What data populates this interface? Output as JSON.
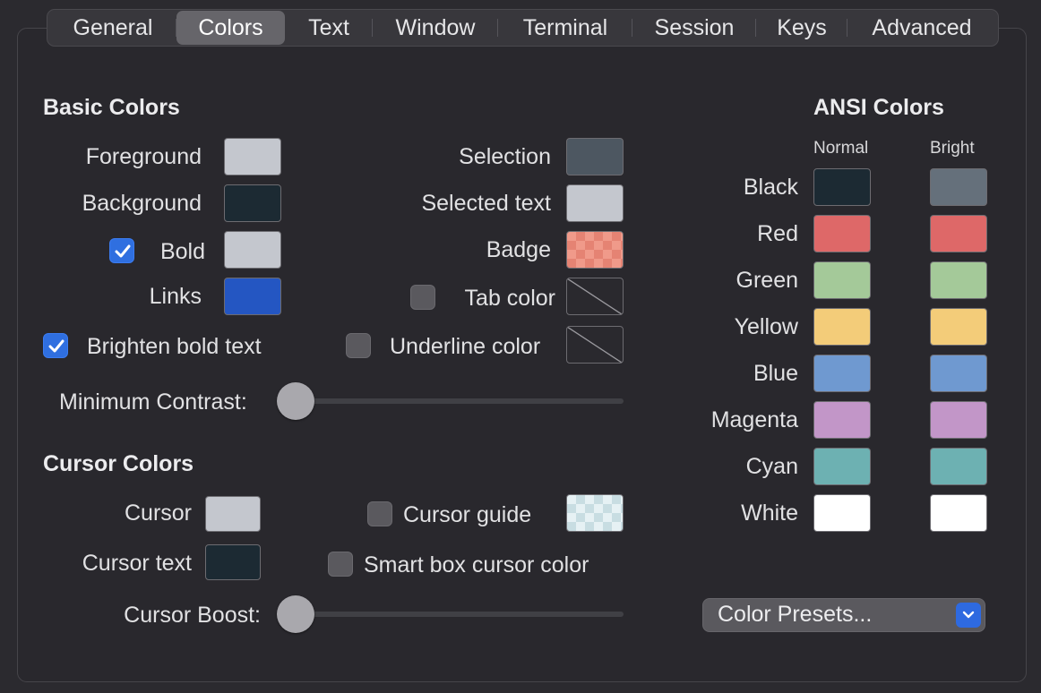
{
  "tabs": [
    "General",
    "Colors",
    "Text",
    "Window",
    "Terminal",
    "Session",
    "Keys",
    "Advanced"
  ],
  "active_tab": "Colors",
  "basic": {
    "heading": "Basic Colors",
    "foreground": {
      "label": "Foreground",
      "color": "#c4c7ce"
    },
    "background": {
      "label": "Background",
      "color": "#1c2a33"
    },
    "bold": {
      "label": "Bold",
      "color": "#c4c7ce",
      "checked": true
    },
    "links": {
      "label": "Links",
      "color": "#2456c2"
    },
    "selection": {
      "label": "Selection",
      "color": "#4d5761"
    },
    "selected_text": {
      "label": "Selected text",
      "color": "#c4c7ce"
    },
    "badge": {
      "label": "Badge",
      "color": "#f09a8a"
    },
    "tab_color": {
      "label": "Tab color",
      "checked": false
    },
    "brighten_bold": {
      "label": "Brighten bold text",
      "checked": true
    },
    "underline_color": {
      "label": "Underline color",
      "checked": false
    },
    "min_contrast": {
      "label": "Minimum Contrast:",
      "value": 0
    }
  },
  "cursor": {
    "heading": "Cursor Colors",
    "cursor": {
      "label": "Cursor",
      "color": "#c4c7ce"
    },
    "cursor_text": {
      "label": "Cursor text",
      "color": "#1c2a33"
    },
    "cursor_guide": {
      "label": "Cursor guide",
      "checked": false
    },
    "smart_box": {
      "label": "Smart box cursor color",
      "checked": false
    },
    "boost": {
      "label": "Cursor Boost:",
      "value": 0
    }
  },
  "ansi": {
    "heading": "ANSI Colors",
    "normal_label": "Normal",
    "bright_label": "Bright",
    "rows": [
      {
        "name": "Black",
        "normal": "#1c2a33",
        "bright": "#65707b"
      },
      {
        "name": "Red",
        "normal": "#de6868",
        "bright": "#de6868"
      },
      {
        "name": "Green",
        "normal": "#a4c999",
        "bright": "#a4c999"
      },
      {
        "name": "Yellow",
        "normal": "#f3cc79",
        "bright": "#f3cc79"
      },
      {
        "name": "Blue",
        "normal": "#6f99d0",
        "bright": "#6f99d0"
      },
      {
        "name": "Magenta",
        "normal": "#c296c8",
        "bright": "#c296c8"
      },
      {
        "name": "Cyan",
        "normal": "#6db1b2",
        "bright": "#6db1b2"
      },
      {
        "name": "White",
        "normal": "#ffffff",
        "bright": "#ffffff"
      }
    ]
  },
  "presets": {
    "label": "Color Presets..."
  }
}
